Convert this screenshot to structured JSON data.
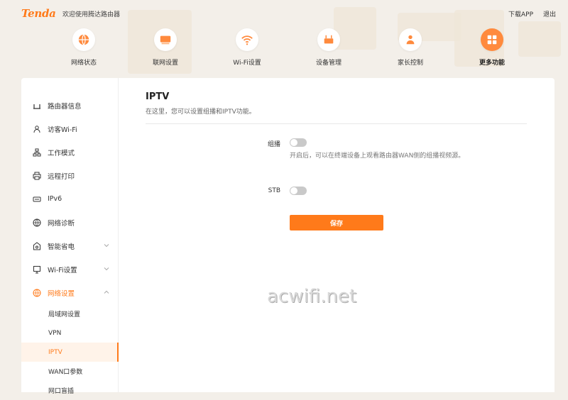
{
  "header": {
    "logo": "Tenda",
    "welcome": "欢迎使用腾达路由器",
    "download_app": "下载APP",
    "logout": "退出"
  },
  "nav": [
    {
      "label": "网络状态",
      "icon": "globe-icon"
    },
    {
      "label": "联网设置",
      "icon": "router-icon"
    },
    {
      "label": "Wi-Fi设置",
      "icon": "wifi-icon"
    },
    {
      "label": "设备管理",
      "icon": "device-icon"
    },
    {
      "label": "家长控制",
      "icon": "parental-icon"
    },
    {
      "label": "更多功能",
      "icon": "grid-icon",
      "active": true
    }
  ],
  "sidebar": {
    "items": [
      {
        "label": "路由器信息",
        "icon": "router-info-icon"
      },
      {
        "label": "访客Wi-Fi",
        "icon": "guest-icon"
      },
      {
        "label": "工作模式",
        "icon": "mode-icon"
      },
      {
        "label": "远程打印",
        "icon": "printer-icon"
      },
      {
        "label": "IPv6",
        "icon": "ipv6-icon"
      },
      {
        "label": "网络诊断",
        "icon": "diagnose-icon"
      },
      {
        "label": "智能省电",
        "icon": "power-icon"
      },
      {
        "label": "Wi-Fi设置",
        "icon": "wifi-settings-icon"
      },
      {
        "label": "网络设置",
        "icon": "network-settings-icon"
      }
    ],
    "sub_items": [
      "局域网设置",
      "VPN",
      "IPTV",
      "WAN口参数",
      "网口盲插"
    ]
  },
  "content": {
    "title": "IPTV",
    "description": "在这里，您可以设置组播和IPTV功能。",
    "multicast_label": "组播",
    "multicast_hint": "开启后，可以在终端设备上观看路由器WAN侧的组播视频源。",
    "stb_label": "STB",
    "save_label": "保存"
  },
  "watermark": "acwifi.net",
  "colors": {
    "accent": "#ff7a1a",
    "toggle_off": "#c9c9c9"
  }
}
